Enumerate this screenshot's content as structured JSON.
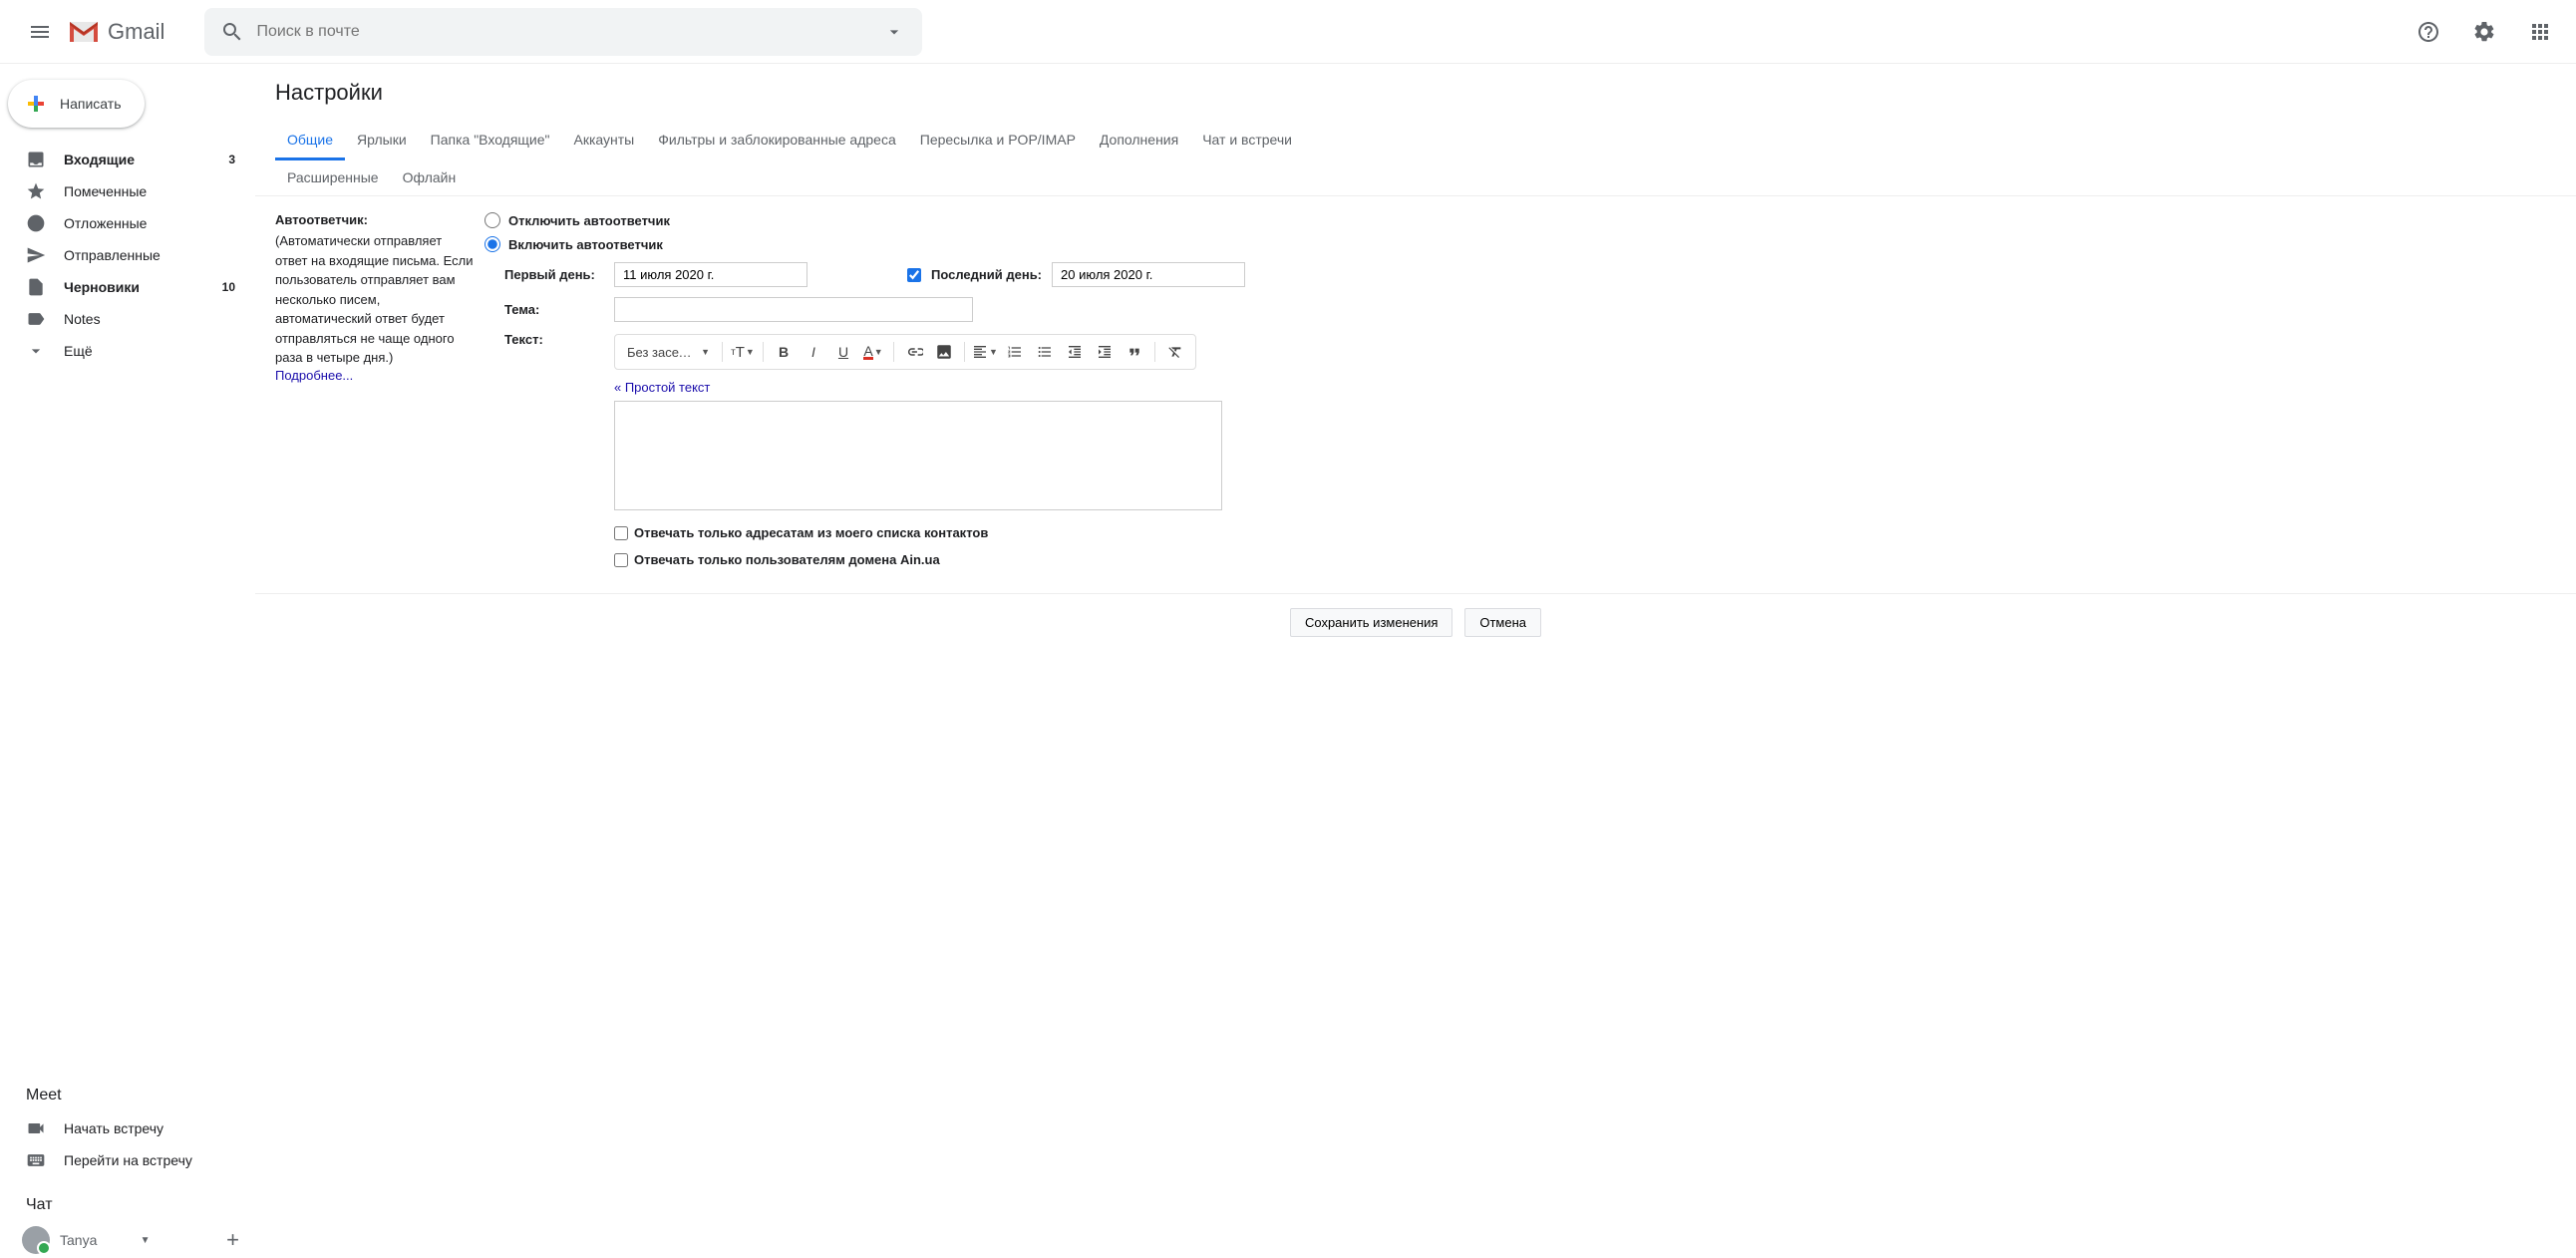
{
  "header": {
    "app_name": "Gmail",
    "search_placeholder": "Поиск в почте"
  },
  "compose_label": "Написать",
  "sidebar": {
    "items": [
      {
        "label": "Входящие",
        "count": "3",
        "bold": true
      },
      {
        "label": "Помеченные",
        "count": ""
      },
      {
        "label": "Отложенные",
        "count": ""
      },
      {
        "label": "Отправленные",
        "count": ""
      },
      {
        "label": "Черновики",
        "count": "10",
        "bold": true
      },
      {
        "label": "Notes",
        "count": ""
      },
      {
        "label": "Ещё",
        "count": ""
      }
    ],
    "meet_title": "Meet",
    "meet_start": "Начать встречу",
    "meet_join": "Перейти на встречу",
    "chat_title": "Чат",
    "chat_user": "Tanya"
  },
  "page_title": "Настройки",
  "tabs": {
    "row1": [
      "Общие",
      "Ярлыки",
      "Папка \"Входящие\"",
      "Аккаунты",
      "Фильтры и заблокированные адреса",
      "Пересылка и POP/IMAP",
      "Дополнения",
      "Чат и встречи"
    ],
    "row2": [
      "Расширенные",
      "Офлайн"
    ]
  },
  "section": {
    "title": "Автоответчик:",
    "desc": "(Автоматически отправляет ответ на входящие письма. Если пользователь отправляет вам несколько писем, автоматический ответ будет отправляться не чаще одного раза в четыре дня.)",
    "learn_more": "Подробнее...",
    "radio_off": "Отключить автоответчик",
    "radio_on": "Включить автоответчик",
    "first_day_label": "Первый день:",
    "first_day_value": "11 июля 2020 г.",
    "last_day_label": "Последний день:",
    "last_day_value": "20 июля 2020 г.",
    "subject_label": "Тема:",
    "subject_value": "",
    "text_label": "Текст:",
    "font_select": "Без засеч…",
    "plain_text_link": "« Простой текст",
    "cb_contacts": "Отвечать только адресатам из моего списка контактов",
    "cb_domain": "Отвечать только пользователям домена Ain.ua"
  },
  "actions": {
    "save": "Сохранить изменения",
    "cancel": "Отмена"
  }
}
